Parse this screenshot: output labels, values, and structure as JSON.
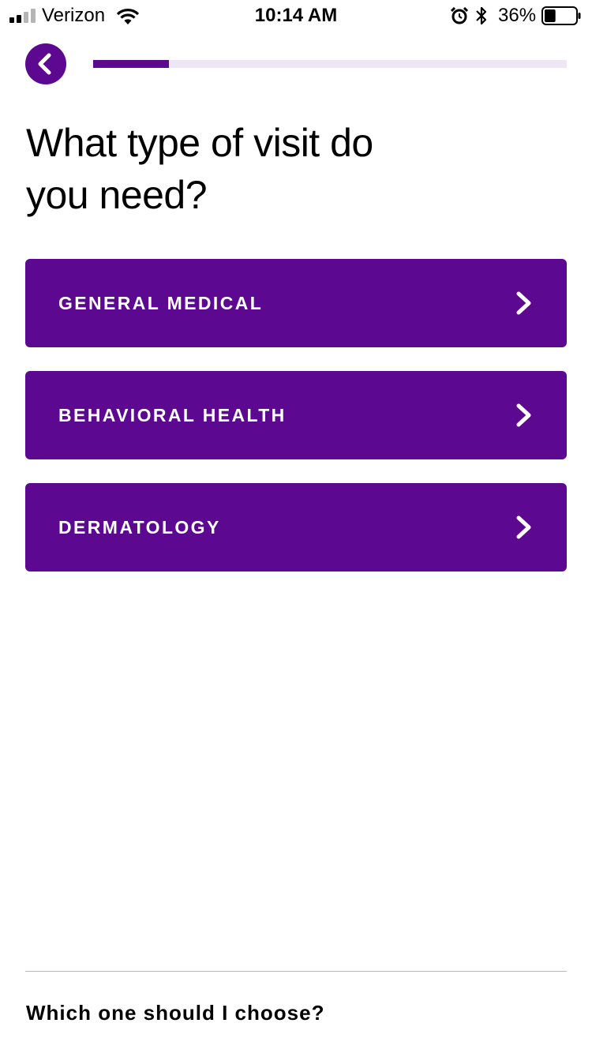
{
  "status_bar": {
    "carrier": "Verizon",
    "time": "10:14 AM",
    "battery_percent": "36%",
    "battery_level": 0.36,
    "signal_bars_filled": 2,
    "signal_bars_total": 4,
    "icons": [
      "signal-icon",
      "wifi-icon",
      "alarm-icon",
      "bluetooth-icon",
      "battery-icon"
    ]
  },
  "header": {
    "back_icon": "chevron-left-icon",
    "progress": 0.16
  },
  "page": {
    "title_line1": "What type of visit do",
    "title_line2": "you need?"
  },
  "options": [
    {
      "label": "GENERAL MEDICAL",
      "icon": "chevron-right-icon"
    },
    {
      "label": "BEHAVIORAL HEALTH",
      "icon": "chevron-right-icon"
    },
    {
      "label": "DERMATOLOGY",
      "icon": "chevron-right-icon"
    }
  ],
  "footer": {
    "help_text": "Which one should I choose?"
  },
  "colors": {
    "brand_purple": "#5c0891",
    "progress_track": "#efe6f5",
    "divider": "#b9b9b9",
    "text": "#000000",
    "button_text": "#ffffff"
  }
}
